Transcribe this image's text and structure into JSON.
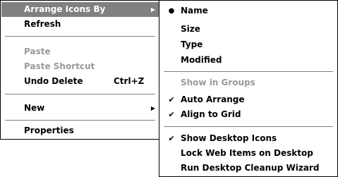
{
  "context_menu": {
    "items": [
      {
        "label": "Arrange Icons By",
        "submenu": true,
        "highlighted": true,
        "enabled": true
      },
      {
        "label": "Refresh",
        "enabled": true
      },
      {
        "label": "Paste",
        "enabled": false
      },
      {
        "label": "Paste Shortcut",
        "enabled": false
      },
      {
        "label": "Undo Delete",
        "shortcut": "Ctrl+Z",
        "enabled": true
      },
      {
        "label": "New",
        "submenu": true,
        "enabled": true
      },
      {
        "label": "Properties",
        "enabled": true
      }
    ]
  },
  "arrange_submenu": {
    "items": [
      {
        "label": "Name",
        "mark": "bullet",
        "enabled": true
      },
      {
        "label": "Size",
        "enabled": true
      },
      {
        "label": "Type",
        "enabled": true
      },
      {
        "label": "Modified",
        "enabled": true
      },
      {
        "label": "Show in Groups",
        "enabled": false
      },
      {
        "label": "Auto Arrange",
        "mark": "check",
        "enabled": true
      },
      {
        "label": "Align to Grid",
        "mark": "check",
        "enabled": true
      },
      {
        "label": "Show Desktop Icons",
        "mark": "check",
        "enabled": true
      },
      {
        "label": "Lock Web Items on Desktop",
        "enabled": true
      },
      {
        "label": "Run Desktop Cleanup Wizard",
        "enabled": true
      }
    ]
  },
  "glyphs": {
    "submenu_arrow": "▶",
    "bullet": "●",
    "check": "✔"
  },
  "colors": {
    "highlight": "#808080",
    "disabled_text": "#9a9a9a"
  }
}
